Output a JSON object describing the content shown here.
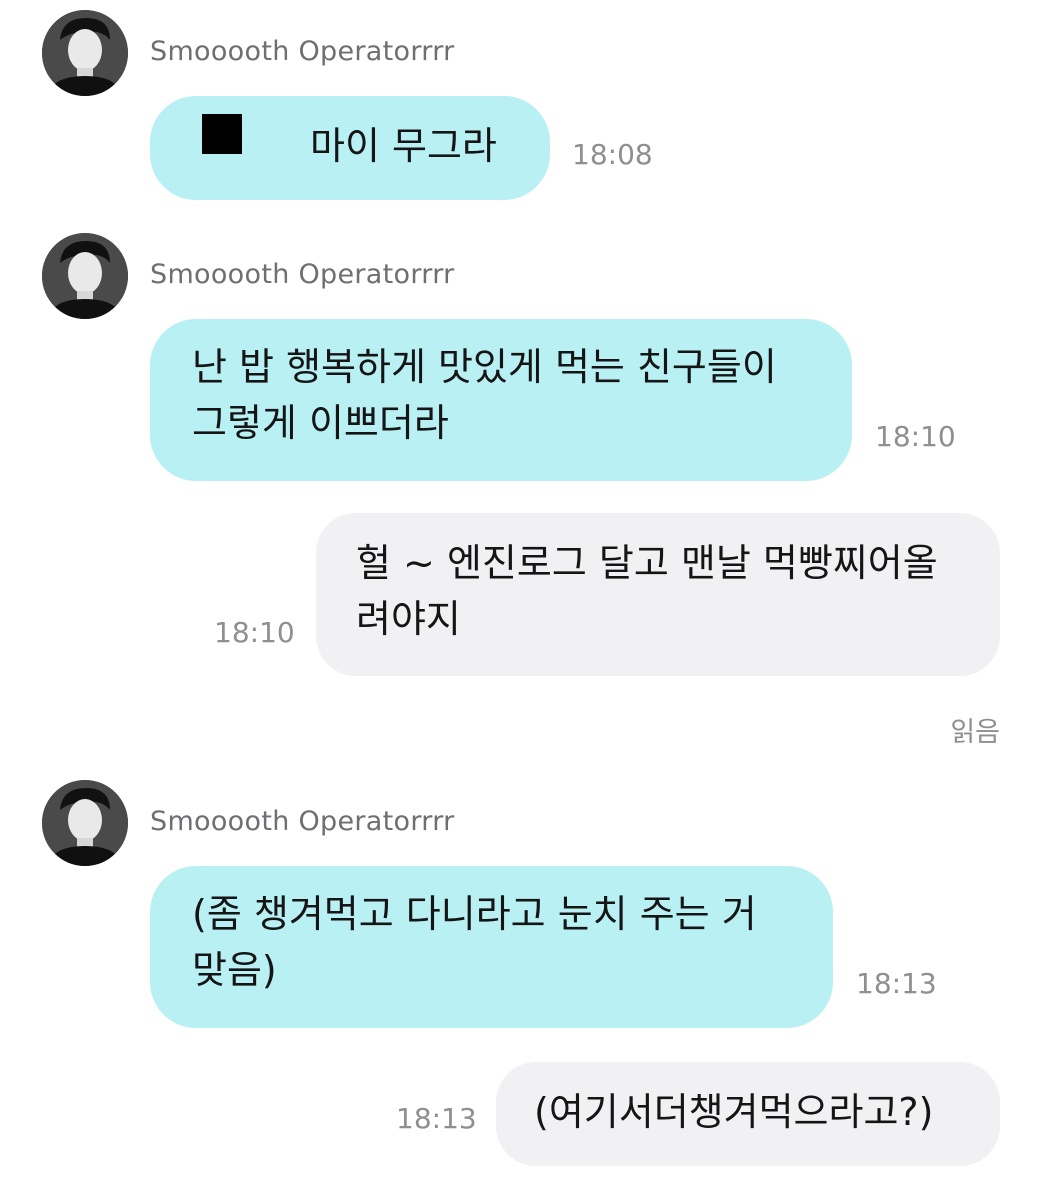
{
  "messages": [
    {
      "sender": "Smooooth Operatorrrr",
      "text": "마이 무그라",
      "time": "18:08"
    },
    {
      "sender": "Smooooth Operatorrrr",
      "lines": [
        "난 밥 행복하게 맛있게 먹는 친구들이",
        "그렇게 이쁘더라"
      ],
      "time": "18:10"
    },
    {
      "lines": [
        "헐 ~ 엔진로그 달고 맨날 먹빵찌어올",
        "려야지"
      ],
      "time": "18:10",
      "status": "읽음"
    },
    {
      "sender": "Smooooth Operatorrrr",
      "lines": [
        "(좀 챙겨먹고 다니라고 눈치 주는 거",
        "맞음)"
      ],
      "time": "18:13"
    },
    {
      "text": "(여기서더챙겨먹으라고?)",
      "time": "18:13"
    }
  ]
}
